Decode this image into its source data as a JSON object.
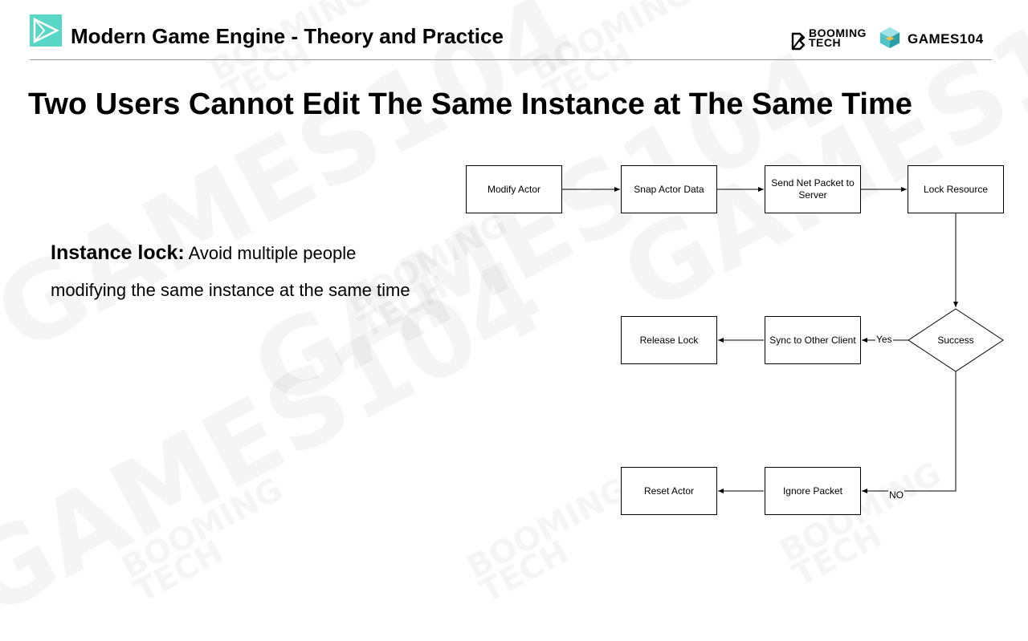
{
  "header": {
    "deck_title": "Modern Game Engine - Theory and Practice",
    "booming_line1": "BOOMING",
    "booming_line2": "TECH",
    "games_label": "GAMES104"
  },
  "slide": {
    "title": "Two Users Cannot Edit The Same Instance at The Same Time",
    "bullet_term": "Instance lock:",
    "bullet_text_1": " Avoid multiple people",
    "bullet_text_2": "modifying the same instance at the same time"
  },
  "flowchart": {
    "nodes": {
      "modify_actor": "Modify Actor",
      "snap_actor_data": "Snap Actor Data",
      "send_net_packet": "Send Net Packet to Server",
      "lock_resource": "Lock Resource",
      "success": "Success",
      "sync_other_client": "Sync to Other Client",
      "release_lock": "Release Lock",
      "ignore_packet": "Ignore Packet",
      "reset_actor": "Reset Actor"
    },
    "edges": {
      "yes": "Yes",
      "no": "NO"
    }
  },
  "colors": {
    "accent": "#5ad6c6",
    "cube_teal": "#4fc3c8",
    "cube_yellow": "#f2c14e"
  }
}
